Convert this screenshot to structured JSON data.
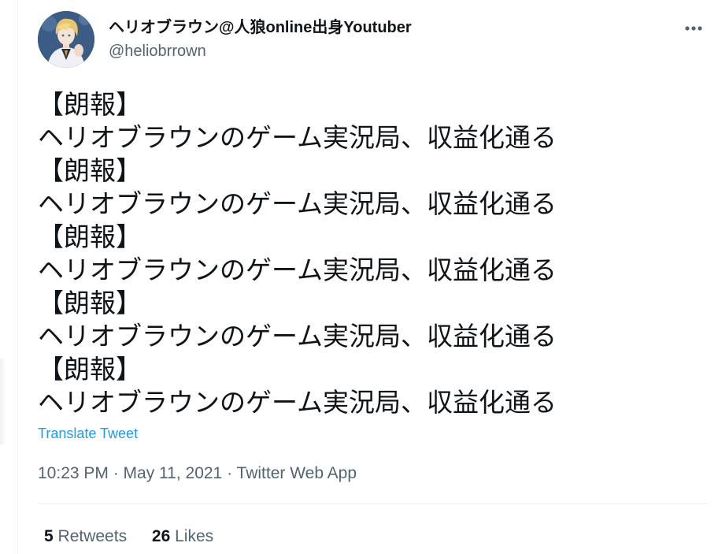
{
  "tweet": {
    "author": {
      "display_name": "ヘリオブラウン@人狼online出身Youtuber",
      "handle": "@heliobrrown",
      "avatar_icon": "avatar-illustration"
    },
    "more_icon": "more-horizontal-icon",
    "lines": [
      "【朗報】",
      "ヘリオブラウンのゲーム実況局、収益化通る",
      "【朗報】",
      "ヘリオブラウンのゲーム実況局、収益化通る",
      "【朗報】",
      "ヘリオブラウンのゲーム実況局、収益化通る",
      "【朗報】",
      "ヘリオブラウンのゲーム実況局、収益化通る",
      "【朗報】",
      "ヘリオブラウンのゲーム実況局、収益化通る"
    ],
    "translate_label": "Translate Tweet",
    "meta": "10:23 PM · May 11, 2021 · Twitter Web App",
    "stats": {
      "retweets_count": "5",
      "retweets_label": "Retweets",
      "likes_count": "26",
      "likes_label": "Likes"
    }
  },
  "colors": {
    "link": "#1d9bf0",
    "secondary_text": "#536471",
    "primary_text": "#0f1419"
  }
}
